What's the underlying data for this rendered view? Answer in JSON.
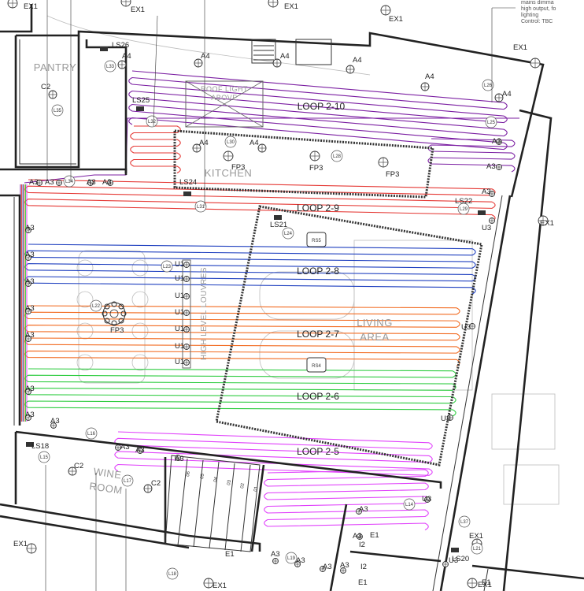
{
  "loops": [
    {
      "label": "LOOP 2-10",
      "color": "#7b1fa2"
    },
    {
      "label": "LOOP 2-9",
      "color": "#e53935"
    },
    {
      "label": "LOOP 2-8",
      "color": "#1e3fbf"
    },
    {
      "label": "LOOP 2-7",
      "color": "#f26b21"
    },
    {
      "label": "LOOP 2-6",
      "color": "#2ecc40"
    },
    {
      "label": "LOOP 2-5",
      "color": "#e040fb"
    }
  ],
  "rooms": {
    "pantry": "PANTRY",
    "kitchen": "KITCHEN",
    "living": [
      "LIVING",
      "AREA"
    ],
    "wine": [
      "WINE",
      "ROOM"
    ],
    "roof_light": [
      "ROOF LIGHT",
      "ABOVE"
    ],
    "louvres": "HIGH LEVEL LOUVRES"
  },
  "note_lines": [
    "mains dimma",
    "high output, fo",
    "lighting",
    "Control: TBC"
  ],
  "ex1_label": "EX1",
  "a3_label": "A3",
  "a4_label": "A4",
  "u1_label": "U1",
  "u3_label": "U3",
  "fp3_label": "FP3",
  "c2_label": "C2",
  "e1_label": "E1",
  "i2_label": "I2",
  "sensors": {
    "ls26": "LS26",
    "ls25": "LS25",
    "ls24": "LS24",
    "ls22": "LS22",
    "ls21": "LS21",
    "ls18": "LS18",
    "ls20": "LS20"
  },
  "room_sensors": {
    "rs5": "RS5",
    "rs4": "RS4"
  },
  "circuit_tags": {
    "l33": "L33",
    "l35": "L35",
    "l32": "L32",
    "l30": "L30",
    "l34": "L34",
    "l31": "L31",
    "l26": "L26",
    "l25": "L25",
    "l28": "L28",
    "l29": "L29",
    "l24": "L24",
    "l23": "L23",
    "l22": "L22",
    "l16": "L16",
    "l15": "L15",
    "l17": "L17",
    "l14": "L14",
    "l37": "L37",
    "l21": "L21",
    "l19": "L19",
    "l18": "L18"
  },
  "stair_numbers": [
    "06",
    "05",
    "04",
    "03",
    "02",
    "01"
  ]
}
